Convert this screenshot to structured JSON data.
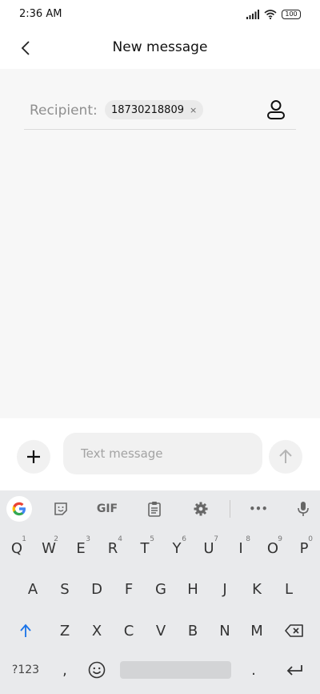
{
  "status": {
    "time": "2:36 AM",
    "battery": "100"
  },
  "header": {
    "title": "New message"
  },
  "recipient": {
    "label": "Recipient:",
    "chip": "18730218809",
    "chip_close": "×"
  },
  "composer": {
    "placeholder": "Text message"
  },
  "keyboard": {
    "toolbar": {
      "gif": "GIF",
      "more": "•••"
    },
    "row1": [
      {
        "key": "Q",
        "hint": "1"
      },
      {
        "key": "W",
        "hint": "2"
      },
      {
        "key": "E",
        "hint": "3"
      },
      {
        "key": "R",
        "hint": "4"
      },
      {
        "key": "T",
        "hint": "5"
      },
      {
        "key": "Y",
        "hint": "6"
      },
      {
        "key": "U",
        "hint": "7"
      },
      {
        "key": "I",
        "hint": "8"
      },
      {
        "key": "O",
        "hint": "9"
      },
      {
        "key": "P",
        "hint": "0"
      }
    ],
    "row2": [
      "A",
      "S",
      "D",
      "F",
      "G",
      "H",
      "J",
      "K",
      "L"
    ],
    "row3": [
      "Z",
      "X",
      "C",
      "V",
      "B",
      "N",
      "M"
    ],
    "bottom": {
      "symbols": "?123",
      "comma": ",",
      "period": "."
    }
  }
}
